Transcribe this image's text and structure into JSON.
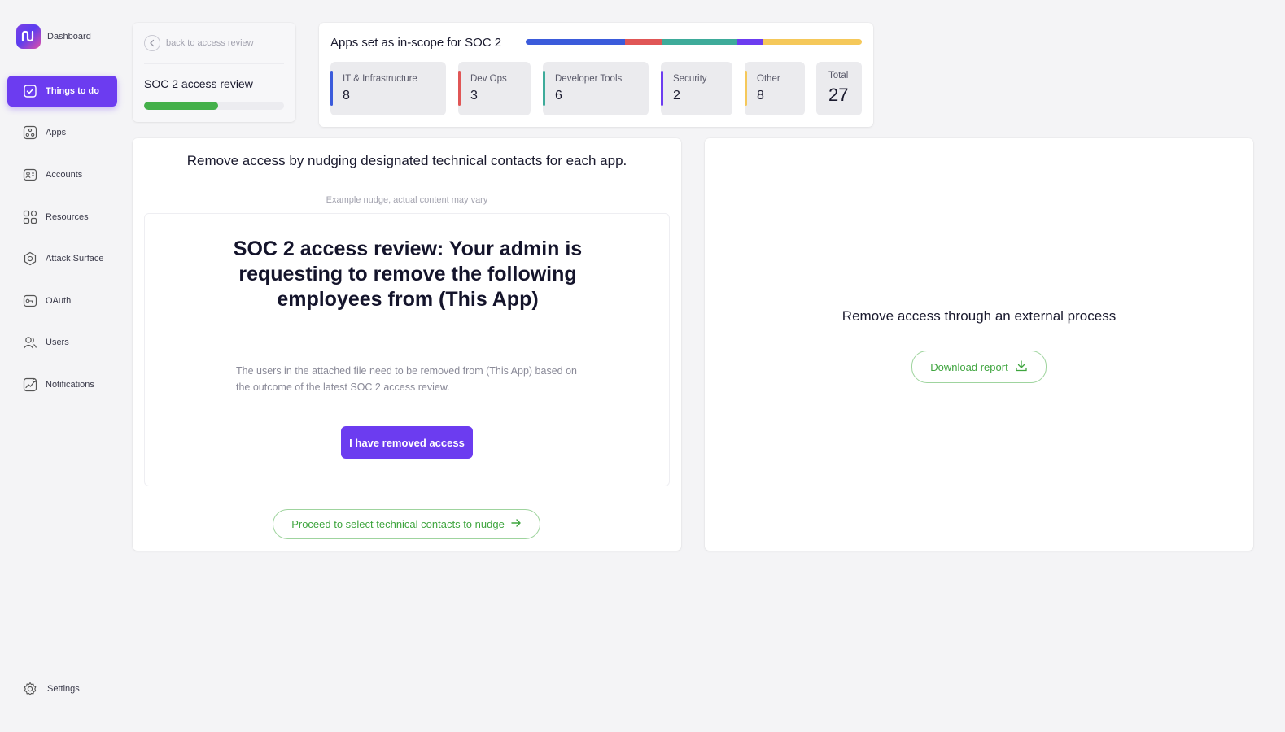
{
  "brand": {
    "label": "Dashboard"
  },
  "sidebar": {
    "items": [
      {
        "label": "Things to do",
        "icon": "checkbox-icon",
        "active": true
      },
      {
        "label": "Apps",
        "icon": "apps-icon"
      },
      {
        "label": "Accounts",
        "icon": "accounts-icon"
      },
      {
        "label": "Resources",
        "icon": "resources-icon"
      },
      {
        "label": "Attack Surface",
        "icon": "attack-surface-icon"
      },
      {
        "label": "OAuth",
        "icon": "oauth-icon"
      },
      {
        "label": "Users",
        "icon": "users-icon"
      },
      {
        "label": "Notifications",
        "icon": "notifications-icon"
      }
    ],
    "settings_label": "Settings"
  },
  "review": {
    "back_label": "back to access review",
    "title": "SOC 2 access review",
    "progress": 0.53
  },
  "scope": {
    "title": "Apps set as in-scope for SOC 2",
    "categories": [
      {
        "label": "IT & Infrastructure",
        "count": "8",
        "color": "#3b5bdb"
      },
      {
        "label": "Dev Ops",
        "count": "3",
        "color": "#e05656"
      },
      {
        "label": "Developer Tools",
        "count": "6",
        "color": "#3eab9a"
      },
      {
        "label": "Security",
        "count": "2",
        "color": "#6c3cf0"
      },
      {
        "label": "Other",
        "count": "8",
        "color": "#f5c85a"
      }
    ],
    "total_label": "Total",
    "total": "27"
  },
  "nudge": {
    "heading": "Remove access by nudging designated technical contacts for each app.",
    "example_note": "Example nudge, actual content may vary",
    "preview_title": "SOC 2 access review: Your admin is requesting to remove the following employees from (This App)",
    "preview_body": "The users in the attached file need to be removed from (This App) based on the outcome of the latest SOC 2 access review.",
    "removed_button": "I have removed access",
    "proceed_button": "Proceed to select technical contacts to nudge"
  },
  "external": {
    "heading": "Remove access through an external process",
    "download_button": "Download report"
  }
}
